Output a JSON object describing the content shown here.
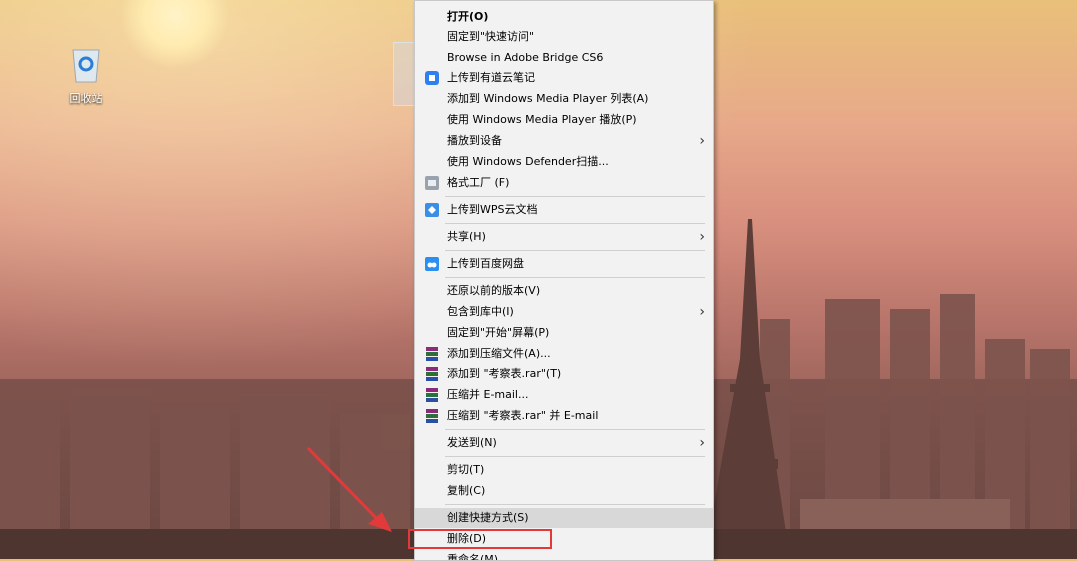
{
  "desktop": {
    "recycle_bin_label": "回收站"
  },
  "context_menu": {
    "items": [
      {
        "label": "打开(O)"
      },
      {
        "label": "固定到\"快速访问\""
      },
      {
        "label": "Browse in Adobe Bridge CS6"
      },
      {
        "label": "上传到有道云笔记",
        "icon": "youdao-note-icon"
      },
      {
        "label": "添加到 Windows Media Player 列表(A)"
      },
      {
        "label": "使用 Windows Media Player 播放(P)"
      },
      {
        "label": "播放到设备",
        "submenu": true
      },
      {
        "label": "使用 Windows Defender扫描..."
      },
      {
        "label": "格式工厂 (F)",
        "icon": "format-factory-icon"
      },
      {
        "label": "上传到WPS云文档",
        "icon": "wps-cloud-icon"
      },
      {
        "label": "共享(H)",
        "submenu": true
      },
      {
        "label": "上传到百度网盘",
        "icon": "baidu-netdisk-icon"
      },
      {
        "label": "还原以前的版本(V)"
      },
      {
        "label": "包含到库中(I)",
        "submenu": true
      },
      {
        "label": "固定到\"开始\"屏幕(P)"
      },
      {
        "label": "添加到压缩文件(A)...",
        "icon": "winrar-icon"
      },
      {
        "label": "添加到 \"考察表.rar\"(T)",
        "icon": "winrar-icon"
      },
      {
        "label": "压缩并 E-mail...",
        "icon": "winrar-icon"
      },
      {
        "label": "压缩到 \"考察表.rar\" 并 E-mail",
        "icon": "winrar-icon"
      },
      {
        "label": "发送到(N)",
        "submenu": true
      },
      {
        "label": "剪切(T)"
      },
      {
        "label": "复制(C)"
      },
      {
        "label": "创建快捷方式(S)"
      },
      {
        "label": "删除(D)"
      },
      {
        "label": "重命名(M)"
      }
    ]
  },
  "colors": {
    "highlight_box": "#e23a3a",
    "menu_bg": "#f2f2f2"
  }
}
